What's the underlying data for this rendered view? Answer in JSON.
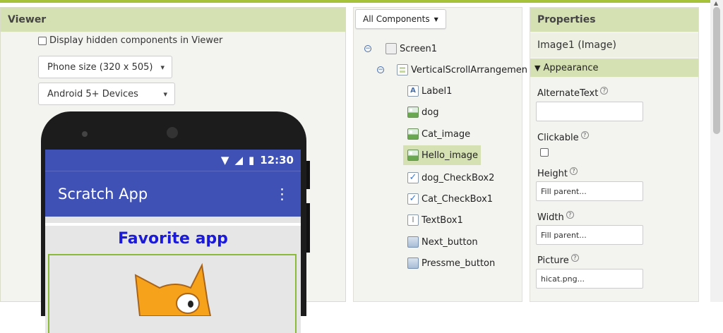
{
  "viewer": {
    "title": "Viewer",
    "hidden_label": "Display hidden components in Viewer",
    "size_select": "Phone size (320 x 505)",
    "device_select": "Android 5+ Devices"
  },
  "phone": {
    "time": "12:30",
    "app_title": "Scratch App",
    "menu": "⋮",
    "heading": "Favorite app"
  },
  "components": {
    "dropdown": "All Components",
    "tree": [
      {
        "label": "Screen1",
        "icon": "screen-icon"
      },
      {
        "label": "VerticalScrollArrangemen",
        "icon": "vertical-arrangement-icon"
      },
      {
        "label": "Label1",
        "icon": "label-icon"
      },
      {
        "label": "dog",
        "icon": "image-icon"
      },
      {
        "label": "Cat_image",
        "icon": "image-icon"
      },
      {
        "label": "Hello_image",
        "icon": "image-icon"
      },
      {
        "label": "dog_CheckBox2",
        "icon": "checkbox-icon"
      },
      {
        "label": "Cat_CheckBox1",
        "icon": "checkbox-icon"
      },
      {
        "label": "TextBox1",
        "icon": "textbox-icon"
      },
      {
        "label": "Next_button",
        "icon": "button-icon"
      },
      {
        "label": "Pressme_button",
        "icon": "button-icon"
      }
    ]
  },
  "properties": {
    "title": "Properties",
    "component": "Image1 (Image)",
    "section": "Appearance",
    "alt_text_label": "AlternateText",
    "alt_text_value": "",
    "clickable_label": "Clickable",
    "height_label": "Height",
    "height_value": "Fill parent...",
    "width_label": "Width",
    "width_value": "Fill parent...",
    "picture_label": "Picture",
    "picture_value": "hicat.png..."
  },
  "colors": {
    "accent": "#d5e1b3",
    "phone_bar": "#3f51b5",
    "heading_text": "#1a1ad8"
  }
}
